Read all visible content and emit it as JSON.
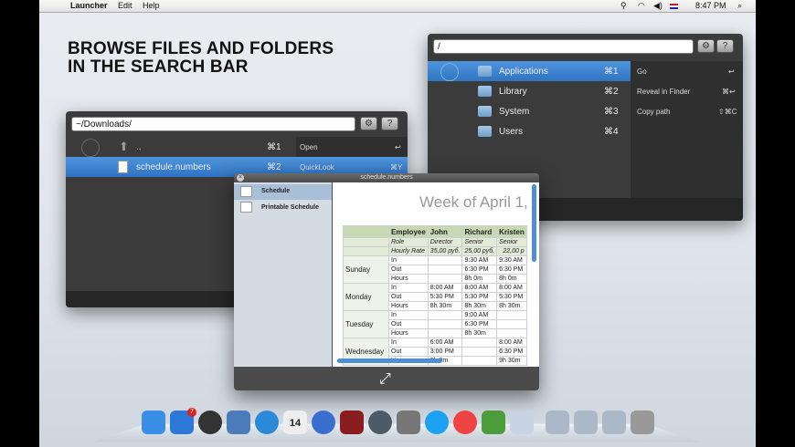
{
  "menubar": {
    "app": "Launcher",
    "edit": "Edit",
    "help": "Help",
    "clock": "8:47 PM"
  },
  "headline": {
    "line1": "BROWSE FILES AND FOLDERS",
    "line2": "IN THE SEARCH BAR"
  },
  "launcher_right": {
    "query": "/",
    "items": [
      {
        "label": "Applications",
        "shortcut": "⌘1"
      },
      {
        "label": "Library",
        "shortcut": "⌘2"
      },
      {
        "label": "System",
        "shortcut": "⌘3"
      },
      {
        "label": "Users",
        "shortcut": "⌘4"
      }
    ],
    "actions": [
      {
        "label": "Go",
        "shortcut": "↩"
      },
      {
        "label": "Reveal in Finder",
        "shortcut": "⌘↩"
      },
      {
        "label": "Copy path",
        "shortcut": "⇧⌘C"
      }
    ]
  },
  "launcher_left": {
    "query": "~/Downloads/",
    "items": [
      {
        "label": "..",
        "shortcut": "⌘1"
      },
      {
        "label": "schedule.numbers",
        "shortcut": "⌘2"
      }
    ],
    "actions": [
      {
        "label": "Open",
        "shortcut": "↩"
      },
      {
        "label": "QuickLook",
        "shortcut": "⌘Y"
      }
    ]
  },
  "quicklook": {
    "title": "schedule.numbers",
    "sheets": [
      "Schedule",
      "Printable Schedule"
    ],
    "doc_title": "Week of April 1,",
    "columns": [
      "Employee",
      "John",
      "Richard",
      "Kristen"
    ],
    "roles": [
      "Role",
      "Director",
      "Senior",
      "Senior"
    ],
    "rates": [
      "Hourly Rate",
      "35,00 руб.",
      "25,00 руб.",
      "22,00 р"
    ],
    "days": [
      {
        "day": "Sunday",
        "rows": [
          [
            "In",
            "",
            "9:30 AM",
            "9:30 AM"
          ],
          [
            "Out",
            "",
            "6:30 PM",
            "6:30 PM"
          ],
          [
            "Hours",
            "",
            "8h 0m",
            "8h 0m"
          ]
        ]
      },
      {
        "day": "Monday",
        "rows": [
          [
            "In",
            "8:00 AM",
            "8:00 AM",
            "8:00 AM"
          ],
          [
            "Out",
            "5:30 PM",
            "5:30 PM",
            "5:30 PM"
          ],
          [
            "Hours",
            "8h 30m",
            "8h 30m",
            "8h 30m"
          ]
        ]
      },
      {
        "day": "Tuesday",
        "rows": [
          [
            "In",
            "",
            "9:00 AM",
            ""
          ],
          [
            "Out",
            "",
            "6:30 PM",
            ""
          ],
          [
            "Hours",
            "",
            "8h 30m",
            ""
          ]
        ]
      },
      {
        "day": "Wednesday",
        "rows": [
          [
            "In",
            "6:00 AM",
            "",
            "8:00 AM"
          ],
          [
            "Out",
            "3:00 PM",
            "",
            "6:30 PM"
          ],
          [
            "Hours",
            "8h 0m",
            "",
            "9h 30m"
          ]
        ]
      }
    ]
  },
  "dock": {
    "icons": [
      "finder-icon",
      "app-store-icon",
      "dashboard-icon",
      "preview-icon",
      "safari-icon",
      "calendar-icon",
      "itunes-icon",
      "photo-booth-icon",
      "time-machine-icon",
      "system-preferences-icon",
      "skype-icon",
      "chrome-icon",
      "adium-icon",
      "rocket-icon",
      "applications-folder-icon",
      "documents-folder-icon",
      "downloads-folder-icon",
      "trash-icon"
    ],
    "calendar_day": "14",
    "appstore_badge": "7"
  }
}
